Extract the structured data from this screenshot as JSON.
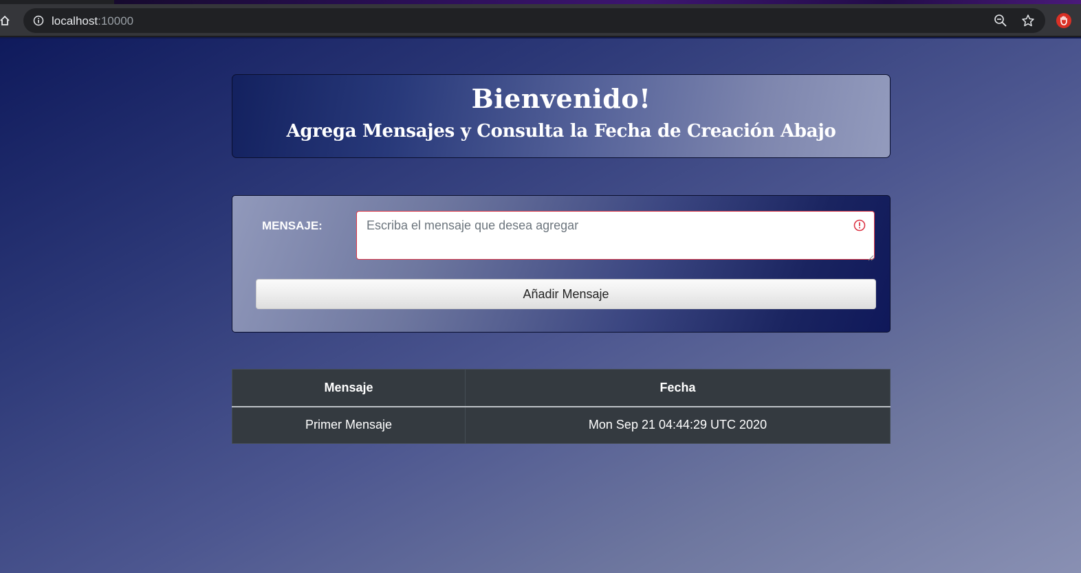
{
  "browser": {
    "url_host": "localhost",
    "url_port": ":10000"
  },
  "header": {
    "title": "Bienvenido!",
    "subtitle": "Agrega Mensajes y Consulta la Fecha de Creación Abajo"
  },
  "form": {
    "label": "MENSAJE:",
    "placeholder": "Escriba el mensaje que desea agregar",
    "value": "",
    "button_label": "Añadir Mensaje"
  },
  "table": {
    "headers": [
      "Mensaje",
      "Fecha"
    ],
    "rows": [
      [
        "Primer Mensaje",
        "Mon Sep 21 04:44:29 UTC 2020"
      ]
    ]
  },
  "colors": {
    "error": "#dc3545",
    "table_bg": "#343a40",
    "extension_red": "#d93025"
  },
  "icons": {
    "home": "home-icon",
    "info": "info-icon",
    "zoom": "zoom-out-icon",
    "bookmark": "star-icon",
    "extension": "hand-stop-icon",
    "validation": "error-circle-icon"
  }
}
